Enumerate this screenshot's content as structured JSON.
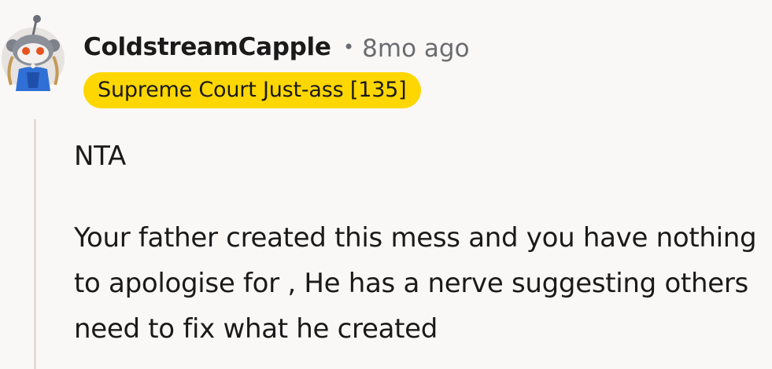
{
  "comment": {
    "username": "ColdstreamCapple",
    "separator": "•",
    "time_ago": "8mo ago",
    "flair": "Supreme Court Just-ass [135]",
    "body_paragraphs": [
      "NTA",
      "Your father created this mess and you have nothing to apologise for , He has a nerve suggesting others need to fix what he created"
    ]
  },
  "colors": {
    "background": "#faf8f6",
    "flair_background": "#ffd700",
    "thread_line": "#e2dcd6",
    "meta_text": "#6a6c70"
  },
  "icons": {
    "avatar": "snoo-avatar-icon"
  }
}
